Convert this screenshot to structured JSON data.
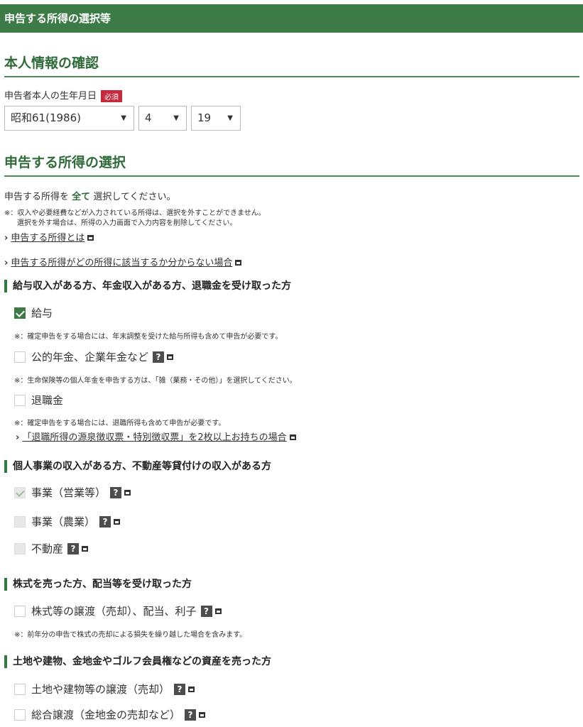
{
  "header": {
    "title": "申告する所得の選択等"
  },
  "identity": {
    "section_title": "本人情報の確認",
    "dob_label": "申告者本人の生年月日",
    "required_badge": "必須",
    "era_year": "昭和61(1986)",
    "month": "4",
    "day": "19"
  },
  "income_select": {
    "section_title": "申告する所得の選択",
    "instruction_prefix": "申告する所得を",
    "instruction_emph": "全て",
    "instruction_suffix": "選択してください。",
    "note_line1": "※：収入や必要経費などが入力されている所得は、選択を外すことができません。",
    "note_line2": "選択を外す場合は、所得の入力画面で入力内容を削除してください。",
    "link1": "申告する所得とは",
    "link2": "申告する所得がどの所得に該当するか分からない場合"
  },
  "group1": {
    "title": "給与収入がある方、年金収入がある方、退職金を受け取った方",
    "salary": "給与",
    "salary_note": "※：確定申告をする場合には、年末調整を受けた給与所得も含めて申告が必要です。",
    "pension": "公的年金、企業年金など",
    "pension_note": "※：生命保険等の個人年金を申告する方は、「雑（業務・その他）」を選択してください。",
    "retirement": "退職金",
    "retirement_note": "※：確定申告をする場合には、退職所得も含めて申告が必要です。",
    "retirement_link": "「退職所得の源泉徴収票・特別徴収票」を2枚以上お持ちの場合"
  },
  "group2": {
    "title": "個人事業の収入がある方、不動産等貸付けの収入がある方",
    "business": "事業（営業等）",
    "farming": "事業（農業）",
    "realestate": "不動産"
  },
  "group3": {
    "title": "株式を売った方、配当等を受け取った方",
    "stocks": "株式等の譲渡（売却）、配当、利子",
    "stocks_note": "※：前年分の申告で株式の売却による損失を繰り越した場合を含みます。"
  },
  "group4": {
    "title": "土地や建物、金地金やゴルフ会員権などの資産を売った方",
    "land": "土地や建物等の譲渡（売却）",
    "gold": "総合譲渡（金地金の売却など）"
  },
  "help_icon_text": "?"
}
